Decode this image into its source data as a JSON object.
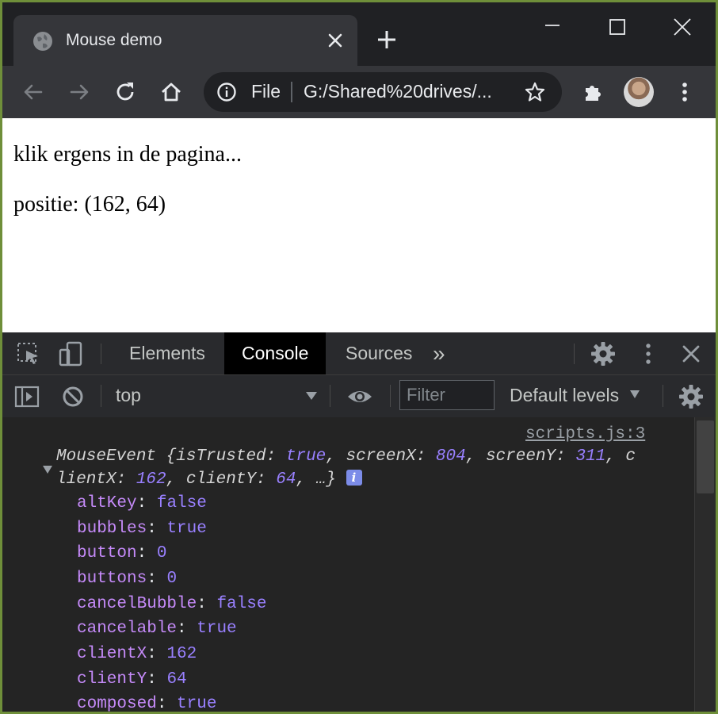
{
  "browser": {
    "tab_title": "Mouse demo",
    "url_scheme": "File",
    "url_display": "G:/Shared%20drives/..."
  },
  "page": {
    "instruction": "klik ergens in de pagina...",
    "position_text": "positie: (162, 64)"
  },
  "devtools": {
    "tabs": [
      {
        "label": "Elements",
        "active": false
      },
      {
        "label": "Console",
        "active": true
      },
      {
        "label": "Sources",
        "active": false
      }
    ],
    "more_tabs": "»",
    "context": "top",
    "filter_placeholder": "Filter",
    "levels": "Default levels"
  },
  "console": {
    "source_link": "scripts.js:3",
    "object_name": "MouseEvent",
    "summary_line1_parts": [
      "{isTrusted: ",
      "true",
      ", screenX: ",
      "804",
      ", screenY: ",
      "311",
      ", c"
    ],
    "summary_line2_parts": [
      "lientX: ",
      "162",
      ", clientY: ",
      "64",
      ", …}"
    ],
    "info_badge": "i",
    "properties": [
      {
        "key": "altKey",
        "value": "false"
      },
      {
        "key": "bubbles",
        "value": "true"
      },
      {
        "key": "button",
        "value": "0"
      },
      {
        "key": "buttons",
        "value": "0"
      },
      {
        "key": "cancelBubble",
        "value": "false"
      },
      {
        "key": "cancelable",
        "value": "true"
      },
      {
        "key": "clientX",
        "value": "162"
      },
      {
        "key": "clientY",
        "value": "64"
      },
      {
        "key": "composed",
        "value": "true"
      }
    ]
  },
  "colors": {
    "frame_border": "#6f8f3a",
    "chrome_dark": "#202124",
    "tab_active": "#35363a",
    "console_bg": "#242424",
    "property_key": "#c58af9",
    "keyword_value": "#9980ff"
  }
}
